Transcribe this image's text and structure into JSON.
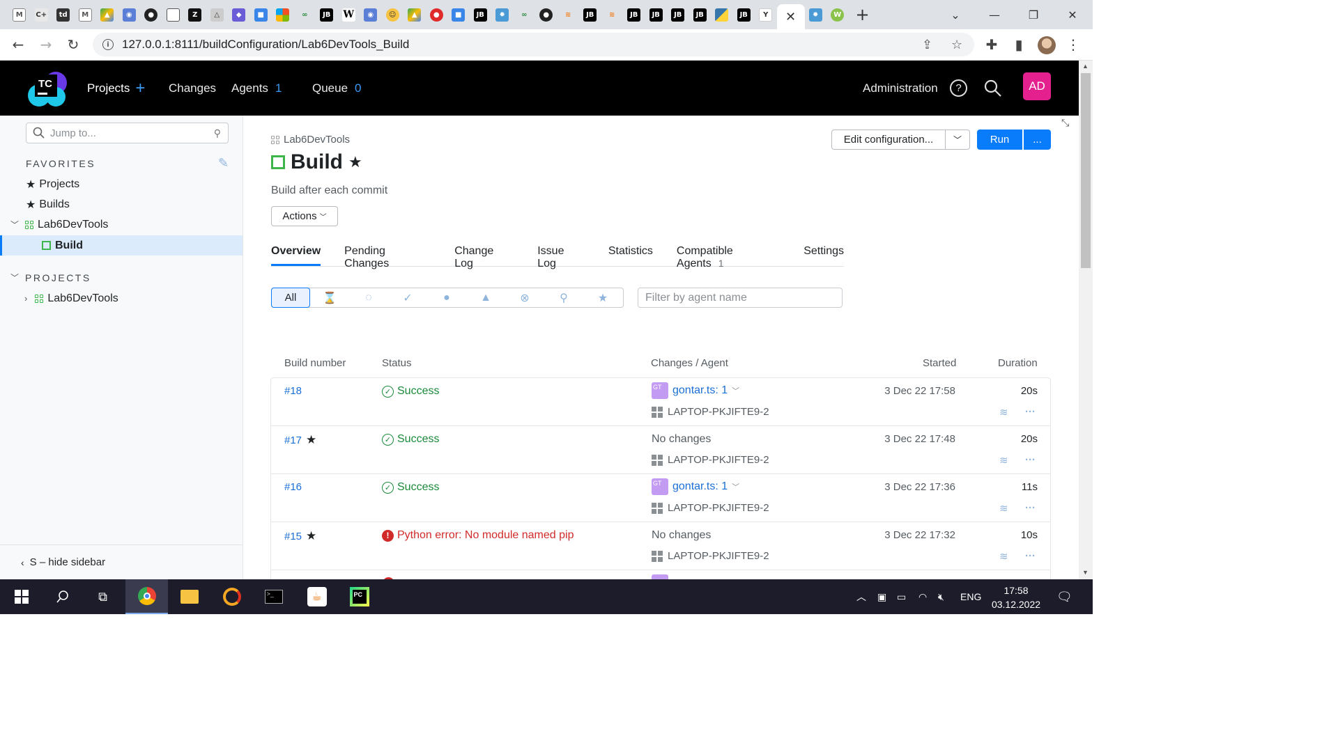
{
  "browser": {
    "url": "127.0.0.1:8111/buildConfiguration/Lab6DevTools_Build",
    "active_tab_close": "✕",
    "new_tab": "+"
  },
  "tc_header": {
    "logo": "TC",
    "nav": {
      "projects": "Projects",
      "changes": "Changes",
      "agents": "Agents",
      "agents_count": "1",
      "queue": "Queue",
      "queue_count": "0"
    },
    "administration": "Administration",
    "user_initials": "AD"
  },
  "sidebar": {
    "jump_placeholder": "Jump to...",
    "favorites_heading": "FAVORITES",
    "favorites": [
      {
        "label": "Projects"
      },
      {
        "label": "Builds"
      },
      {
        "label": "Lab6DevTools"
      },
      {
        "label": "Build"
      }
    ],
    "projects_heading": "PROJECTS",
    "projects": [
      {
        "label": "Lab6DevTools"
      }
    ],
    "hide_sidebar": "S – hide sidebar"
  },
  "main": {
    "breadcrumb": "Lab6DevTools",
    "title": "Build",
    "description": "Build after each commit",
    "actions_label": "Actions",
    "edit_config_label": "Edit configuration...",
    "run_label": "Run",
    "more_label": "...",
    "tabs": [
      {
        "label": "Overview"
      },
      {
        "label": "Pending Changes"
      },
      {
        "label": "Change Log"
      },
      {
        "label": "Issue Log"
      },
      {
        "label": "Statistics"
      },
      {
        "label": "Compatible Agents",
        "count": "1"
      },
      {
        "label": "Settings"
      }
    ],
    "filter_all": "All",
    "agent_filter_placeholder": "Filter by agent name",
    "columns": {
      "build_number": "Build number",
      "status": "Status",
      "changes_agent": "Changes / Agent",
      "started": "Started",
      "duration": "Duration"
    },
    "builds": [
      {
        "number": "#18",
        "starred": false,
        "status": "Success",
        "author_initials": "GT",
        "changes": "gontar.ts: 1",
        "agent": "LAPTOP-PKJIFTE9-2",
        "started": "3 Dec 22 17:58",
        "duration": "20s"
      },
      {
        "number": "#17",
        "starred": true,
        "status": "Success",
        "changes": "No changes",
        "agent": "LAPTOP-PKJIFTE9-2",
        "started": "3 Dec 22 17:48",
        "duration": "20s"
      },
      {
        "number": "#16",
        "starred": false,
        "status": "Success",
        "author_initials": "GT",
        "changes": "gontar.ts: 1",
        "agent": "LAPTOP-PKJIFTE9-2",
        "started": "3 Dec 22 17:36",
        "duration": "11s"
      },
      {
        "number": "#15",
        "starred": true,
        "status": "Python error: No module named pip",
        "changes": "No changes",
        "agent": "LAPTOP-PKJIFTE9-2",
        "started": "3 Dec 22 17:32",
        "duration": "10s"
      }
    ]
  },
  "taskbar": {
    "language": "ENG",
    "time": "17:58",
    "date": "03.12.2022"
  },
  "colors": {
    "accent": "#087cfa",
    "success": "#1b8a3a",
    "error": "#d12a2a",
    "user_badge": "#e3208d"
  }
}
